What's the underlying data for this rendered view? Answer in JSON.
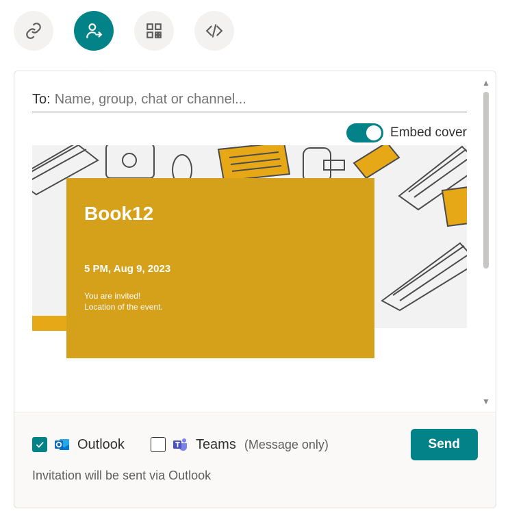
{
  "tabs": [
    {
      "name": "link",
      "active": false
    },
    {
      "name": "people",
      "active": true
    },
    {
      "name": "qr",
      "active": false
    },
    {
      "name": "embed",
      "active": false
    }
  ],
  "share_panel": {
    "to_label": "To:",
    "to_placeholder": "Name, group, chat or channel...",
    "embed_toggle_label": "Embed cover",
    "embed_toggle_on": true,
    "cover": {
      "title": "Book12",
      "datetime": "5 PM, Aug 9, 2023",
      "line1": "You are invited!",
      "line2": "Location of the event."
    },
    "apps": {
      "outlook": {
        "label": "Outlook",
        "checked": true
      },
      "teams": {
        "label": "Teams",
        "checked": false,
        "note": "(Message only)"
      }
    },
    "info_line": "Invitation will be sent via Outlook",
    "send_label": "Send"
  },
  "colors": {
    "accent": "#038387",
    "cover_card": "#d6a11a",
    "cover_accent": "#e6a817"
  }
}
